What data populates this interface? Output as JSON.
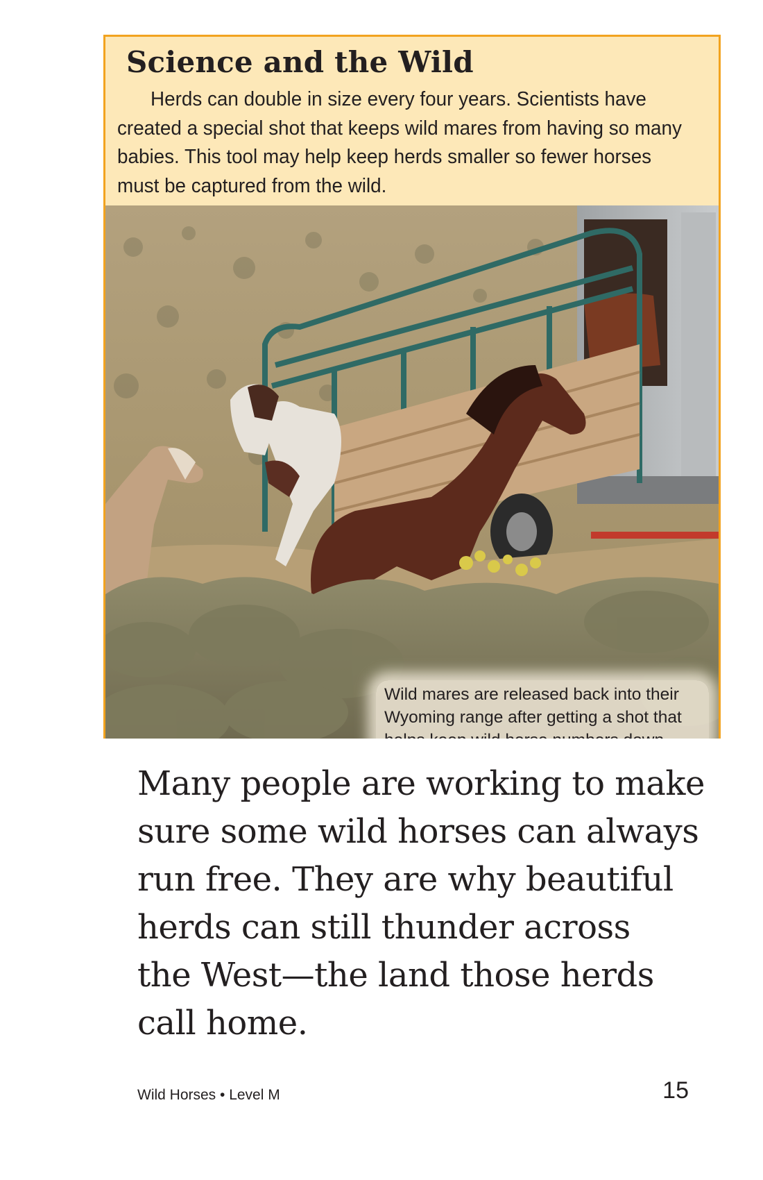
{
  "sidebar": {
    "title": "Science and the Wild",
    "text": "Herds can double in size every four years. Scientists have created a special shot that keeps wild mares from having so many babies. This tool may help keep herds smaller so fewer horses must be captured from the wild."
  },
  "photo": {
    "caption": "Wild mares are released back into their Wyoming range after getting a shot that helps keep wild horse numbers down."
  },
  "body": {
    "lines": [
      "Many people are working to make",
      "sure some wild horses can always",
      "run free. They are why beautiful",
      "herds can still thunder across",
      "the West—the land those herds",
      "call home."
    ]
  },
  "footer": {
    "book_title": "Wild Horses • Level M",
    "page_number": "15"
  },
  "colors": {
    "sidebar_border": "#f2a31f",
    "sidebar_background": "#fde8b8"
  }
}
